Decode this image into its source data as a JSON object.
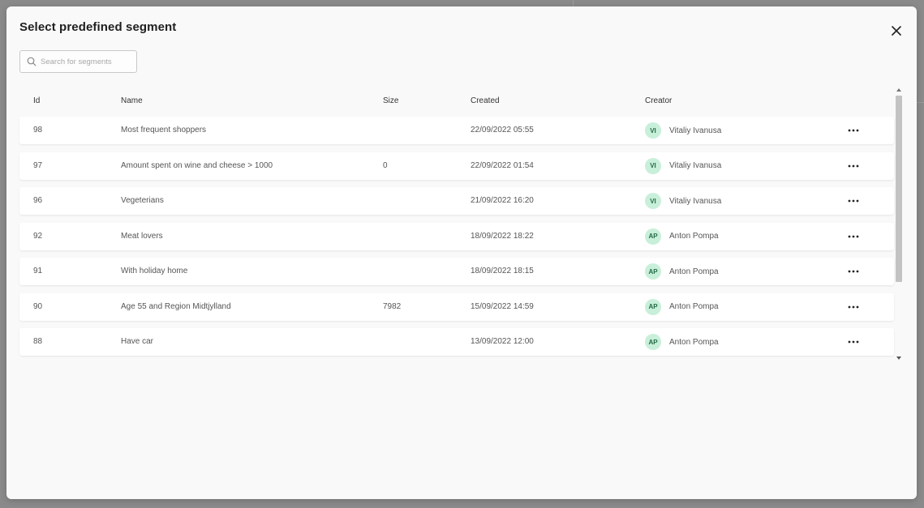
{
  "modal": {
    "title": "Select predefined segment",
    "search_placeholder": "Search for segments"
  },
  "table": {
    "headers": {
      "id": "Id",
      "name": "Name",
      "size": "Size",
      "created": "Created",
      "creator": "Creator"
    },
    "rows": [
      {
        "id": "98",
        "name": "Most frequent shoppers",
        "size": "",
        "created": "22/09/2022 05:55",
        "initials": "VI",
        "creator": "Vitaliy Ivanusa"
      },
      {
        "id": "97",
        "name": "Amount spent on wine and cheese > 1000",
        "size": "0",
        "created": "22/09/2022 01:54",
        "initials": "VI",
        "creator": "Vitaliy Ivanusa"
      },
      {
        "id": "96",
        "name": "Vegeterians",
        "size": "",
        "created": "21/09/2022 16:20",
        "initials": "VI",
        "creator": "Vitaliy Ivanusa"
      },
      {
        "id": "92",
        "name": "Meat lovers",
        "size": "",
        "created": "18/09/2022 18:22",
        "initials": "AP",
        "creator": "Anton Pompa"
      },
      {
        "id": "91",
        "name": "With holiday home",
        "size": "",
        "created": "18/09/2022 18:15",
        "initials": "AP",
        "creator": "Anton Pompa"
      },
      {
        "id": "90",
        "name": "Age 55 and Region Midtjylland",
        "size": "7982",
        "created": "15/09/2022 14:59",
        "initials": "AP",
        "creator": "Anton Pompa"
      },
      {
        "id": "88",
        "name": "Have car",
        "size": "",
        "created": "13/09/2022 12:00",
        "initials": "AP",
        "creator": "Anton Pompa"
      }
    ]
  },
  "icons": {
    "close": "close-icon",
    "search": "search-icon",
    "more": "more-horizontal-icon"
  },
  "colors": {
    "avatar_bg": "#c8efd9",
    "avatar_text": "#256b47",
    "modal_bg": "#f9f9f9"
  }
}
